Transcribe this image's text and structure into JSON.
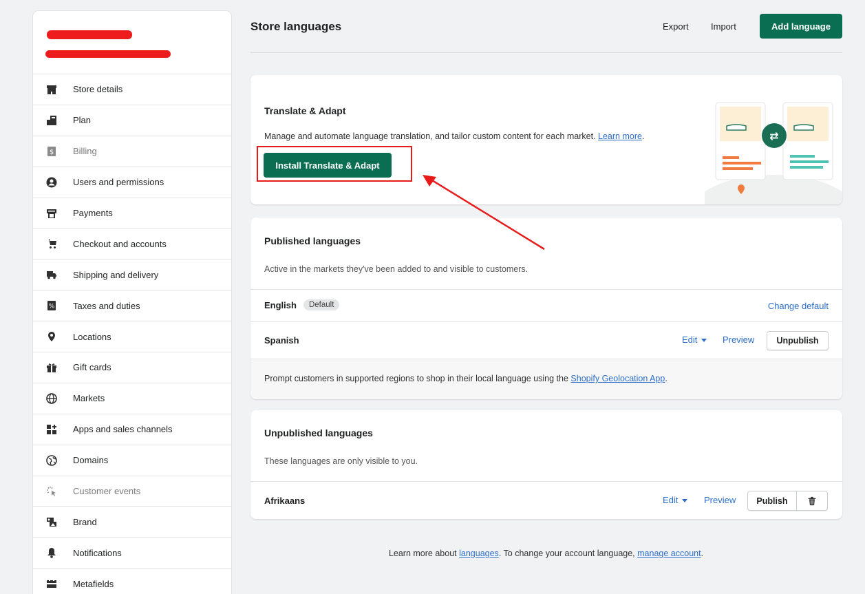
{
  "sidebar": {
    "items": [
      {
        "label": "Store details",
        "icon": "store-icon"
      },
      {
        "label": "Plan",
        "icon": "plan-icon"
      },
      {
        "label": "Billing",
        "icon": "billing-icon"
      },
      {
        "label": "Users and permissions",
        "icon": "user-icon"
      },
      {
        "label": "Payments",
        "icon": "payments-icon"
      },
      {
        "label": "Checkout and accounts",
        "icon": "cart-icon"
      },
      {
        "label": "Shipping and delivery",
        "icon": "truck-icon"
      },
      {
        "label": "Taxes and duties",
        "icon": "tax-icon"
      },
      {
        "label": "Locations",
        "icon": "location-icon"
      },
      {
        "label": "Gift cards",
        "icon": "gift-icon"
      },
      {
        "label": "Markets",
        "icon": "globe-icon"
      },
      {
        "label": "Apps and sales channels",
        "icon": "apps-icon"
      },
      {
        "label": "Domains",
        "icon": "domains-icon"
      },
      {
        "label": "Customer events",
        "icon": "cursor-icon"
      },
      {
        "label": "Brand",
        "icon": "brand-icon"
      },
      {
        "label": "Notifications",
        "icon": "bell-icon"
      },
      {
        "label": "Metafields",
        "icon": "metafields-icon"
      }
    ]
  },
  "header": {
    "title": "Store languages",
    "export_label": "Export",
    "import_label": "Import",
    "add_label": "Add language"
  },
  "translate_card": {
    "title": "Translate & Adapt",
    "description": "Manage and automate language translation, and tailor custom content for each market.",
    "learn_more": "Learn more",
    "install_label": "Install Translate & Adapt"
  },
  "published": {
    "title": "Published languages",
    "subtitle": "Active in the markets they've been added to and visible to customers.",
    "languages": [
      {
        "name": "English",
        "badge": "Default",
        "action": "Change default"
      },
      {
        "name": "Spanish",
        "edit": "Edit",
        "preview": "Preview",
        "button": "Unpublish"
      }
    ],
    "prompt_text": "Prompt customers in supported regions to shop in their local language using the",
    "prompt_link": "Shopify Geolocation App",
    "prompt_end": "."
  },
  "unpublished": {
    "title": "Unpublished languages",
    "subtitle": "These languages are only visible to you.",
    "languages": [
      {
        "name": "Afrikaans",
        "edit": "Edit",
        "preview": "Preview",
        "button": "Publish"
      }
    ]
  },
  "footer": {
    "prefix": "Learn more about",
    "languages_link": "languages",
    "middle": ". To change your account language,",
    "account_link": "manage account",
    "suffix": "."
  },
  "colors": {
    "primary": "#0a6f52",
    "link": "#2c6ecb",
    "annotation": "#e81b1b"
  }
}
